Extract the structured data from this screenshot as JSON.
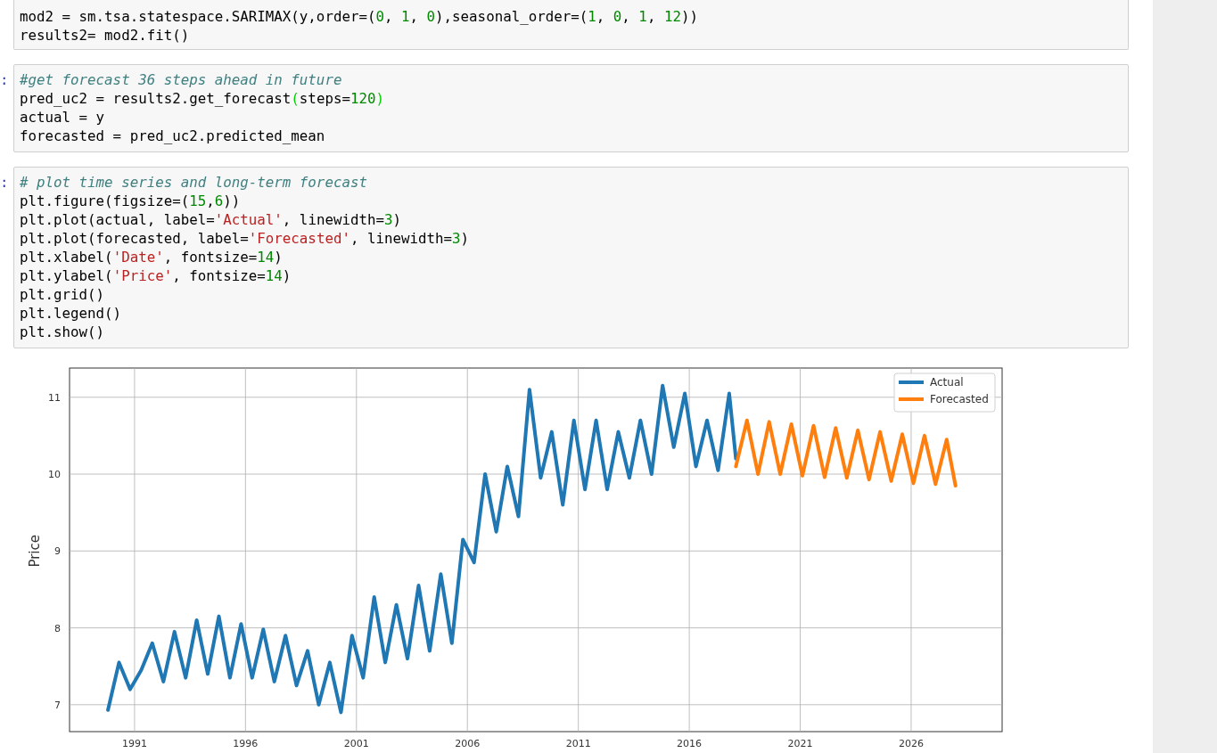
{
  "cells": [
    {
      "lines": [
        [
          {
            "kind": "plain",
            "text": "mod2 = sm.tsa.statespace.SARIMAX(y,order=("
          },
          {
            "kind": "number",
            "text": "0"
          },
          {
            "kind": "plain",
            "text": ", "
          },
          {
            "kind": "number",
            "text": "1"
          },
          {
            "kind": "plain",
            "text": ", "
          },
          {
            "kind": "number",
            "text": "0"
          },
          {
            "kind": "plain",
            "text": "),seasonal_order=("
          },
          {
            "kind": "number",
            "text": "1"
          },
          {
            "kind": "plain",
            "text": ", "
          },
          {
            "kind": "number",
            "text": "0"
          },
          {
            "kind": "plain",
            "text": ", "
          },
          {
            "kind": "number",
            "text": "1"
          },
          {
            "kind": "plain",
            "text": ", "
          },
          {
            "kind": "number",
            "text": "12"
          },
          {
            "kind": "plain",
            "text": "))"
          }
        ],
        [
          {
            "kind": "plain",
            "text": "results2= mod2.fit()"
          }
        ]
      ]
    },
    {
      "prompt": ":",
      "lines": [
        [
          {
            "kind": "comment",
            "text": "#get forecast 36 steps ahead in future"
          }
        ],
        [
          {
            "kind": "plain",
            "text": "pred_uc2 = results2.get_forecast"
          },
          {
            "kind": "match",
            "text": "("
          },
          {
            "kind": "plain",
            "text": "steps="
          },
          {
            "kind": "number",
            "text": "120"
          },
          {
            "kind": "match",
            "text": ")"
          }
        ],
        [
          {
            "kind": "plain",
            "text": "actual = y"
          }
        ],
        [
          {
            "kind": "plain",
            "text": "forecasted = pred_uc2.predicted_mean"
          }
        ]
      ]
    },
    {
      "prompt": ":",
      "lines": [
        [
          {
            "kind": "comment",
            "text": "# plot time series and long-term forecast"
          }
        ],
        [
          {
            "kind": "plain",
            "text": "plt.figure(figsize=("
          },
          {
            "kind": "number",
            "text": "15"
          },
          {
            "kind": "plain",
            "text": ","
          },
          {
            "kind": "number",
            "text": "6"
          },
          {
            "kind": "plain",
            "text": "))"
          }
        ],
        [
          {
            "kind": "plain",
            "text": "plt.plot(actual, label="
          },
          {
            "kind": "string",
            "text": "'Actual'"
          },
          {
            "kind": "plain",
            "text": ", linewidth="
          },
          {
            "kind": "number",
            "text": "3"
          },
          {
            "kind": "plain",
            "text": ")"
          }
        ],
        [
          {
            "kind": "plain",
            "text": "plt.plot(forecasted, label="
          },
          {
            "kind": "string",
            "text": "'Forecasted'"
          },
          {
            "kind": "plain",
            "text": ", linewidth="
          },
          {
            "kind": "number",
            "text": "3"
          },
          {
            "kind": "plain",
            "text": ")"
          }
        ],
        [
          {
            "kind": "plain",
            "text": "plt.xlabel("
          },
          {
            "kind": "string",
            "text": "'Date'"
          },
          {
            "kind": "plain",
            "text": ", fontsize="
          },
          {
            "kind": "number",
            "text": "14"
          },
          {
            "kind": "plain",
            "text": ")"
          }
        ],
        [
          {
            "kind": "plain",
            "text": "plt.ylabel("
          },
          {
            "kind": "string",
            "text": "'Price'"
          },
          {
            "kind": "plain",
            "text": ", fontsize="
          },
          {
            "kind": "number",
            "text": "14"
          },
          {
            "kind": "plain",
            "text": ")"
          }
        ],
        [
          {
            "kind": "plain",
            "text": "plt.grid()"
          }
        ],
        [
          {
            "kind": "plain",
            "text": "plt.legend()"
          }
        ],
        [
          {
            "kind": "plain",
            "text": "plt.show()"
          }
        ]
      ]
    }
  ],
  "output": {
    "chart_data": {
      "type": "line",
      "ylabel": "Price",
      "grid": true,
      "legend": true,
      "xlim": [
        1988.07,
        2030.1
      ],
      "ylim": [
        6.65,
        11.38
      ],
      "xticks": [
        {
          "value": 1991,
          "label": "1991"
        },
        {
          "value": 1996,
          "label": "1996"
        },
        {
          "value": 2001,
          "label": "2001"
        },
        {
          "value": 2006,
          "label": "2006"
        },
        {
          "value": 2011,
          "label": "2011"
        },
        {
          "value": 2016,
          "label": "2016"
        },
        {
          "value": 2021,
          "label": "2021"
        },
        {
          "value": 2026,
          "label": "2026"
        }
      ],
      "yticks": [
        7,
        8,
        9,
        10,
        11
      ],
      "x": [
        1989.8,
        1990.3,
        1990.8,
        1991.3,
        1991.8,
        1992.3,
        1992.8,
        1993.3,
        1993.8,
        1994.3,
        1994.8,
        1995.3,
        1995.8,
        1996.3,
        1996.8,
        1997.3,
        1997.8,
        1998.3,
        1998.8,
        1999.3,
        1999.8,
        2000.3,
        2000.8,
        2001.3,
        2001.8,
        2002.3,
        2002.8,
        2003.3,
        2003.8,
        2004.3,
        2004.8,
        2005.3,
        2005.8,
        2006.3,
        2006.8,
        2007.3,
        2007.8,
        2008.3,
        2008.8,
        2009.3,
        2009.8,
        2010.3,
        2010.8,
        2011.3,
        2011.8,
        2012.3,
        2012.8,
        2013.3,
        2013.8,
        2014.3,
        2014.8,
        2015.3,
        2015.8,
        2016.3,
        2016.8,
        2017.3,
        2017.8,
        2018.1,
        2018.6,
        2019.1,
        2019.6,
        2020.1,
        2020.6,
        2021.1,
        2021.6,
        2022.1,
        2022.6,
        2023.1,
        2023.6,
        2024.1,
        2024.6,
        2025.1,
        2025.6,
        2026.1,
        2026.6,
        2027.1,
        2027.6,
        2028.0
      ],
      "series": [
        {
          "name": "Actual",
          "color": "#1f77b4",
          "values": [
            6.93,
            7.55,
            7.2,
            7.45,
            7.8,
            7.3,
            7.95,
            7.35,
            8.1,
            7.4,
            8.15,
            7.35,
            8.05,
            7.35,
            7.98,
            7.3,
            7.9,
            7.25,
            7.7,
            7.0,
            7.55,
            6.9,
            7.9,
            7.35,
            8.4,
            7.55,
            8.3,
            7.6,
            8.55,
            7.7,
            8.7,
            7.8,
            9.15,
            8.85,
            10.0,
            9.25,
            10.1,
            9.45,
            11.1,
            9.95,
            10.55,
            9.6,
            10.7,
            9.8,
            10.7,
            9.8,
            10.55,
            9.95,
            10.7,
            10.0,
            11.15,
            10.35,
            11.05,
            10.1,
            10.7,
            10.05,
            11.05,
            10.2,
            null,
            null,
            null,
            null,
            null,
            null,
            null,
            null,
            null,
            null,
            null,
            null,
            null,
            null,
            null,
            null,
            null,
            null,
            null,
            null
          ]
        },
        {
          "name": "Forecasted",
          "color": "#ff7f0e",
          "values": [
            null,
            null,
            null,
            null,
            null,
            null,
            null,
            null,
            null,
            null,
            null,
            null,
            null,
            null,
            null,
            null,
            null,
            null,
            null,
            null,
            null,
            null,
            null,
            null,
            null,
            null,
            null,
            null,
            null,
            null,
            null,
            null,
            null,
            null,
            null,
            null,
            null,
            null,
            null,
            null,
            null,
            null,
            null,
            null,
            null,
            null,
            null,
            null,
            null,
            null,
            null,
            null,
            null,
            null,
            null,
            null,
            null,
            10.1,
            10.7,
            10.0,
            10.68,
            10.0,
            10.65,
            9.98,
            10.63,
            9.96,
            10.6,
            9.95,
            10.57,
            9.93,
            10.55,
            9.91,
            10.52,
            9.88,
            10.5,
            9.87,
            10.45,
            9.85
          ]
        }
      ]
    }
  }
}
